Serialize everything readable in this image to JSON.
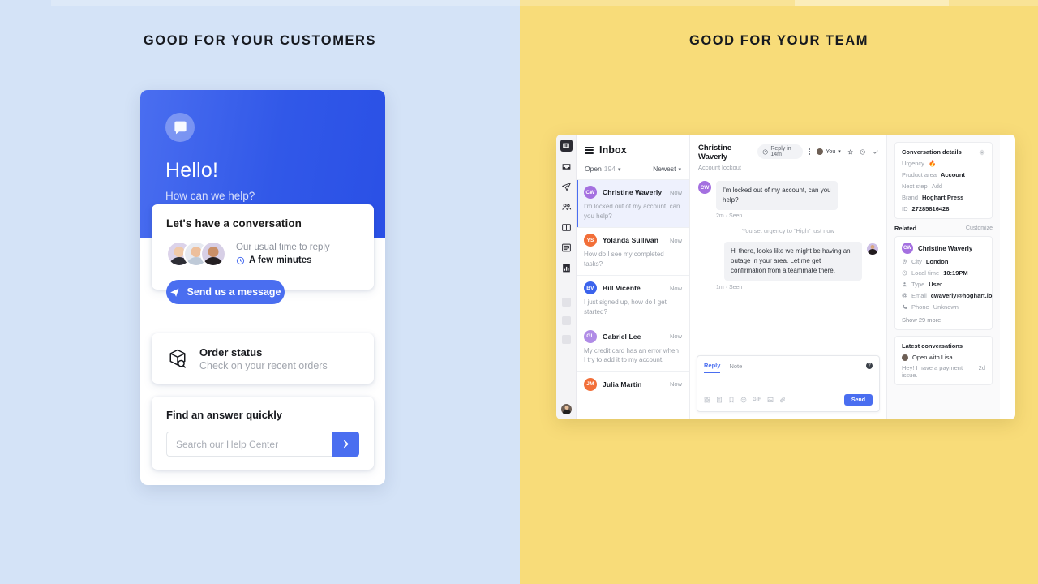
{
  "sections": {
    "left_heading": "GOOD FOR YOUR CUSTOMERS",
    "right_heading": "GOOD FOR YOUR TEAM"
  },
  "colors": {
    "left_bg": "#d4e3f7",
    "right_bg": "#f8dc79",
    "brand_blue": "#4a6ef0",
    "purple_avatar": "#a470e0",
    "orange_avatar": "#f26f39"
  },
  "messenger": {
    "logo_icon": "intercom-logo-icon",
    "greeting": "Hello!",
    "subgreeting": "How can we help?",
    "conversation_card": {
      "title": "Let's have a conversation",
      "reply_label": "Our usual time to reply",
      "reply_time": "A few minutes",
      "clock_icon": "clock-icon",
      "button_label": "Send us a message",
      "button_icon": "paper-plane-icon"
    },
    "order_card": {
      "icon": "package-search-icon",
      "title": "Order status",
      "subtitle": "Check on your recent orders"
    },
    "search_card": {
      "title": "Find an answer quickly",
      "placeholder": "Search our Help Center",
      "value": "",
      "submit_icon": "chevron-right-icon"
    }
  },
  "inbox": {
    "rail": [
      {
        "name": "app-logo",
        "icon": "intercom-logo-icon"
      },
      {
        "name": "inbox",
        "icon": "inbox-icon"
      },
      {
        "name": "outbound",
        "icon": "paper-plane-icon"
      },
      {
        "name": "contacts",
        "icon": "people-icon"
      },
      {
        "name": "articles",
        "icon": "book-icon"
      },
      {
        "name": "messenger",
        "icon": "messenger-icon"
      },
      {
        "name": "reports",
        "icon": "reports-icon"
      }
    ],
    "list": {
      "title": "Inbox",
      "menu_icon": "hamburger-icon",
      "filter_label": "Open",
      "filter_count": "194",
      "sort_label": "Newest",
      "items": [
        {
          "initials": "CW",
          "color": "#a470e0",
          "name": "Christine Waverly",
          "time": "Now",
          "preview": "I'm locked out of my account, can you help?",
          "active": true
        },
        {
          "initials": "YS",
          "color": "#f26f39",
          "name": "Yolanda Sullivan",
          "time": "Now",
          "preview": "How do I see my completed tasks?",
          "active": false
        },
        {
          "initials": "BV",
          "color": "#3b63ec",
          "name": "Bill Vicente",
          "time": "Now",
          "preview": "I just signed up, how do I get started?",
          "active": false
        },
        {
          "initials": "GL",
          "color": "#b08ce6",
          "name": "Gabriel Lee",
          "time": "Now",
          "preview": "My credit card has an error when I try to add it to my account.",
          "active": false
        },
        {
          "initials": "JM",
          "color": "#f26f39",
          "name": "Julia Martin",
          "time": "Now",
          "preview": "",
          "active": false
        }
      ]
    },
    "conversation": {
      "customer_name": "Christine Waverly",
      "subject": "Account lockout",
      "sla_badge": "Reply in 14m",
      "sla_icon": "clock-icon",
      "more_icon": "more-vertical-icon",
      "assignee_label": "You",
      "assignee_caret": "▾",
      "star_icon": "star-icon",
      "snooze_icon": "clock-icon",
      "close_icon": "check-icon",
      "messages": [
        {
          "direction": "in",
          "initials": "CW",
          "color": "#a470e0",
          "text": "I'm locked out of my account, can you help?",
          "meta": "2m · Seen"
        },
        {
          "direction": "system",
          "text": "You set urgency to “High” just now"
        },
        {
          "direction": "out",
          "text": "Hi there, looks like we might be having an outage in your area. Let me get confirmation from a teammate there.",
          "meta": "1m · Seen"
        }
      ],
      "composer": {
        "tabs": [
          "Reply",
          "Note"
        ],
        "active_tab": "Reply",
        "help_icon": "question-mark-icon",
        "value": "",
        "tools": [
          "shortcut-icon",
          "article-icon",
          "saved-reply-icon",
          "emoji-icon",
          "gif-icon",
          "image-icon",
          "attachment-icon"
        ],
        "send_label": "Send"
      }
    },
    "details": {
      "conversation_details": {
        "title": "Conversation details",
        "settings_icon": "gear-icon",
        "rows": [
          {
            "key": "Urgency",
            "value": "🔥",
            "bold": false
          },
          {
            "key": "Product area",
            "value": "Account",
            "bold": true
          },
          {
            "key": "Next step",
            "value": "Add",
            "bold": false
          },
          {
            "key": "Brand",
            "value": "Hoghart Press",
            "bold": true
          },
          {
            "key": "ID",
            "value": "27285816428",
            "bold": true
          }
        ]
      },
      "related": {
        "title": "Related",
        "action": "Customize",
        "person": {
          "initials": "CW",
          "name": "Christine Waverly"
        },
        "rows": [
          {
            "icon": "pin-icon",
            "key": "City",
            "value": "London"
          },
          {
            "icon": "clock-icon",
            "key": "Local time",
            "value": "10:19PM"
          },
          {
            "icon": "user-icon",
            "key": "Type",
            "value": "User"
          },
          {
            "icon": "at-icon",
            "key": "Email",
            "value": "cwaverly@hoghart.io"
          },
          {
            "icon": "phone-icon",
            "key": "Phone",
            "value": "Unknown"
          }
        ],
        "show_more": "Show 29 more"
      },
      "latest_conversations": {
        "title": "Latest conversations",
        "item_title": "Open with Lisa",
        "item_preview": "Hey! I have a payment issue.",
        "item_time": "2d"
      }
    }
  }
}
